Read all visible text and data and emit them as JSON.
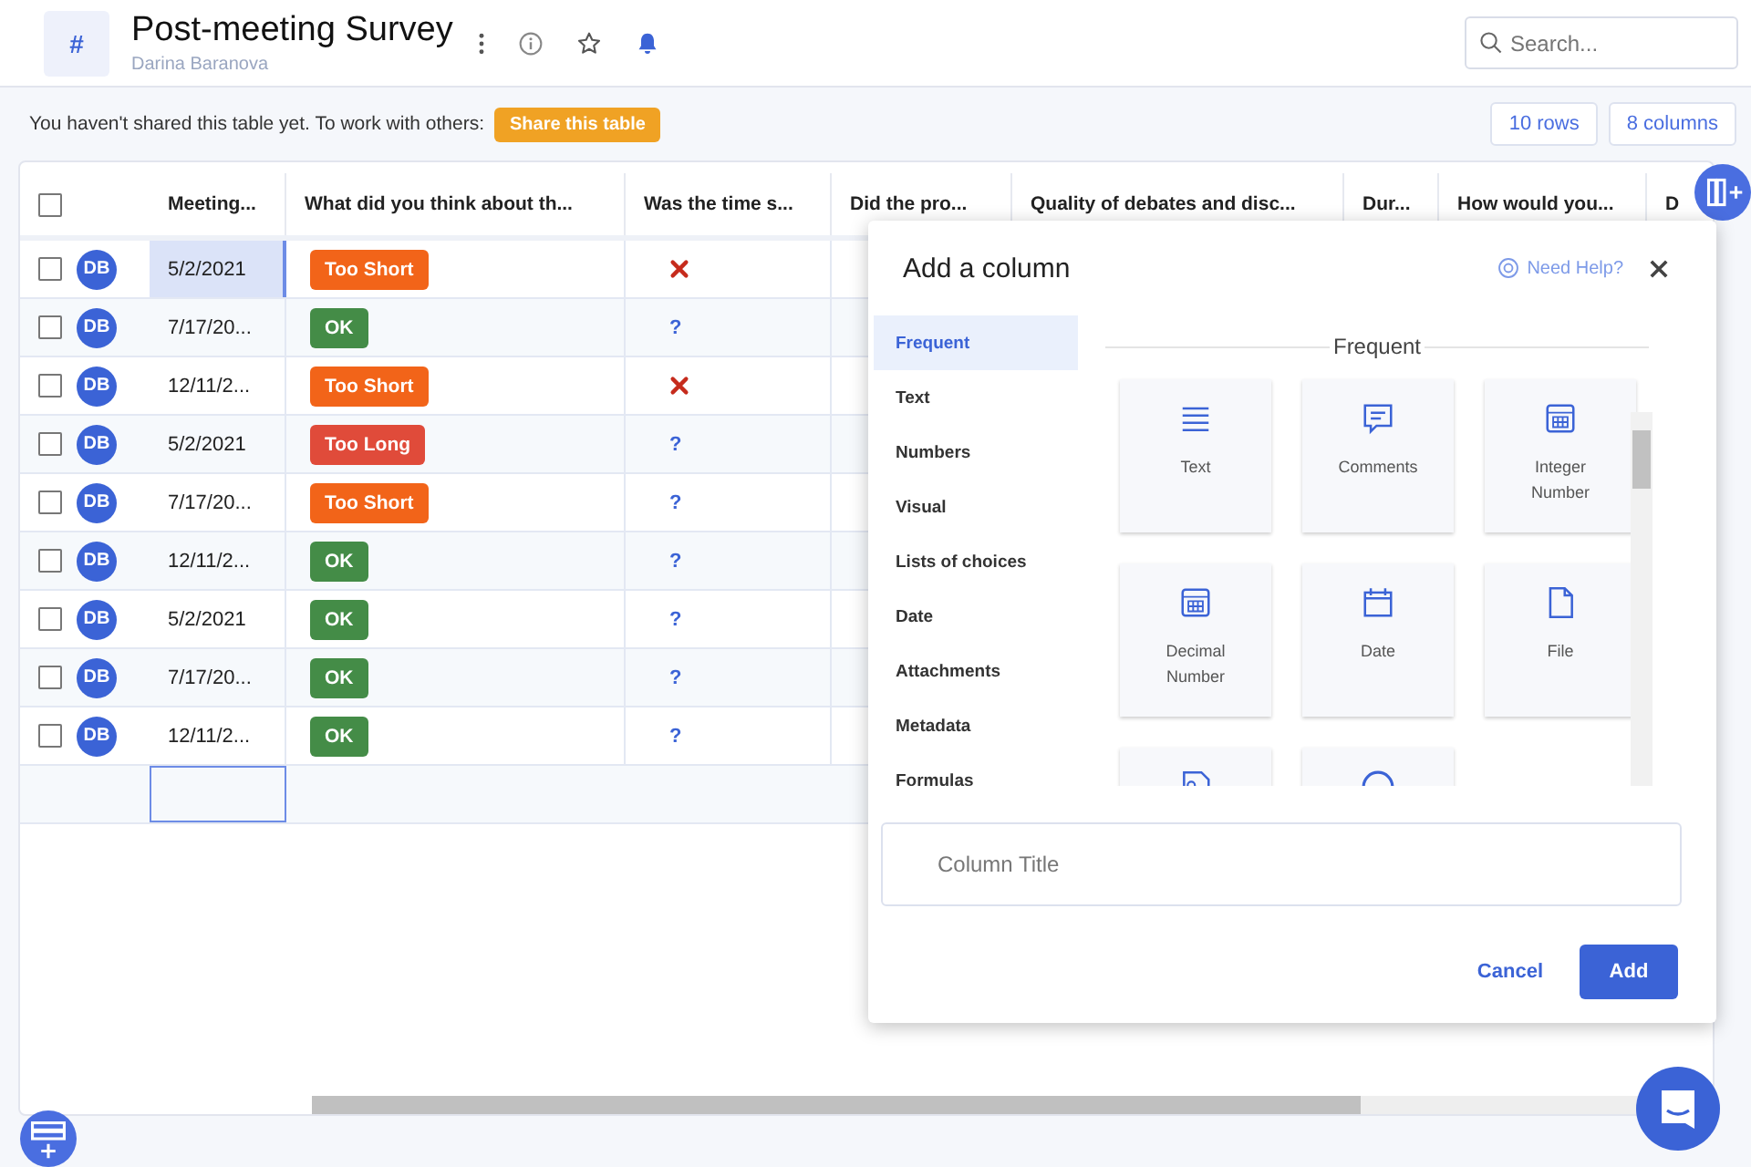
{
  "header": {
    "icon": "#",
    "title": "Post-meeting Survey",
    "owner": "Darina Baranova",
    "search": {
      "placeholder": "Search..."
    }
  },
  "share_bar": {
    "message": "You haven't shared this table yet. To work with others:",
    "button": "Share this table",
    "rows_count": "10 rows",
    "columns_count": "8 columns"
  },
  "table": {
    "select_all_checked": false,
    "columns": [
      "Meeting...",
      "What did you think about th...",
      "Was the time s...",
      "Did the pro...",
      "Quality of debates and disc...",
      "Dur...",
      "How would you...",
      "D"
    ],
    "rows": [
      {
        "checked": false,
        "avatar": "DB",
        "date": "5/2/2021",
        "selected": true,
        "answer": {
          "text": "Too Short",
          "color": "#f26419"
        },
        "time_mark": {
          "kind": "cross"
        }
      },
      {
        "checked": false,
        "avatar": "DB",
        "date": "7/17/20...",
        "selected": false,
        "answer": {
          "text": "OK",
          "color": "#448c47"
        },
        "time_mark": {
          "kind": "question",
          "text": "?"
        }
      },
      {
        "checked": false,
        "avatar": "DB",
        "date": "12/11/2...",
        "selected": false,
        "answer": {
          "text": "Too Short",
          "color": "#f26419"
        },
        "time_mark": {
          "kind": "cross"
        }
      },
      {
        "checked": false,
        "avatar": "DB",
        "date": "5/2/2021",
        "selected": false,
        "answer": {
          "text": "Too Long",
          "color": "#e04b3a"
        },
        "time_mark": {
          "kind": "question",
          "text": "?"
        }
      },
      {
        "checked": false,
        "avatar": "DB",
        "date": "7/17/20...",
        "selected": false,
        "answer": {
          "text": "Too Short",
          "color": "#f26419"
        },
        "time_mark": {
          "kind": "question",
          "text": "?"
        }
      },
      {
        "checked": false,
        "avatar": "DB",
        "date": "12/11/2...",
        "selected": false,
        "answer": {
          "text": "OK",
          "color": "#448c47"
        },
        "time_mark": {
          "kind": "question",
          "text": "?"
        }
      },
      {
        "checked": false,
        "avatar": "DB",
        "date": "5/2/2021",
        "selected": false,
        "answer": {
          "text": "OK",
          "color": "#448c47"
        },
        "time_mark": {
          "kind": "question",
          "text": "?"
        }
      },
      {
        "checked": false,
        "avatar": "DB",
        "date": "7/17/20...",
        "selected": false,
        "answer": {
          "text": "OK",
          "color": "#448c47"
        },
        "time_mark": {
          "kind": "question",
          "text": "?"
        }
      },
      {
        "checked": false,
        "avatar": "DB",
        "date": "12/11/2...",
        "selected": false,
        "answer": {
          "text": "OK",
          "color": "#448c47"
        },
        "time_mark": {
          "kind": "question",
          "text": "?"
        }
      }
    ]
  },
  "dialog": {
    "title": "Add a column",
    "help": "Need Help?",
    "categories": [
      {
        "label": "Frequent",
        "selected": true
      },
      {
        "label": "Text",
        "selected": false
      },
      {
        "label": "Numbers",
        "selected": false
      },
      {
        "label": "Visual",
        "selected": false
      },
      {
        "label": "Lists of choices",
        "selected": false
      },
      {
        "label": "Date",
        "selected": false
      },
      {
        "label": "Attachments",
        "selected": false
      },
      {
        "label": "Metadata",
        "selected": false
      },
      {
        "label": "Formulas",
        "selected": false
      }
    ],
    "section": "Frequent",
    "types": [
      {
        "kind": "lines",
        "label": "Text"
      },
      {
        "kind": "comment",
        "label": "Comments"
      },
      {
        "kind": "grid",
        "label": "Integer Number"
      },
      {
        "kind": "grid",
        "label": "Decimal Number"
      },
      {
        "kind": "calendar",
        "label": "Date"
      },
      {
        "kind": "file",
        "label": "File"
      },
      {
        "kind": "image"
      },
      {
        "kind": "circle"
      }
    ],
    "title_field": {
      "placeholder": "Column Title"
    },
    "cancel": "Cancel",
    "add": "Add"
  }
}
